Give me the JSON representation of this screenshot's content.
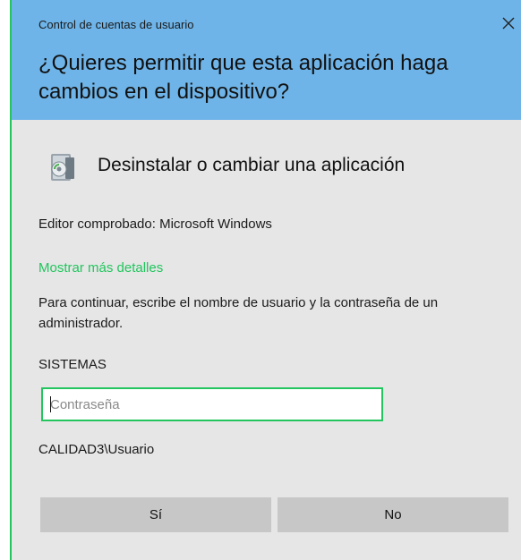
{
  "header": {
    "window_title": "Control de cuentas de usuario",
    "question": "¿Quieres permitir que esta aplicación haga cambios en el dispositivo?",
    "close_icon": "close-icon",
    "colors": {
      "header_bg": "#6fb4e8",
      "body_bg": "#e6e6e6",
      "accent": "#22c55e"
    }
  },
  "app": {
    "icon": "program-installer-icon",
    "name": "Desinstalar o cambiar una aplicación"
  },
  "publisher_text": "Editor comprobado: Microsoft Windows",
  "details_link": "Mostrar más detalles",
  "instructions": "Para continuar, escribe el nombre de usuario y la contraseña de un administrador.",
  "account": {
    "username": "SISTEMAS",
    "password_placeholder": "Contraseña",
    "password_value": "",
    "domain_user": "CALIDAD3\\Usuario"
  },
  "buttons": {
    "yes": "Sí",
    "no": "No"
  }
}
